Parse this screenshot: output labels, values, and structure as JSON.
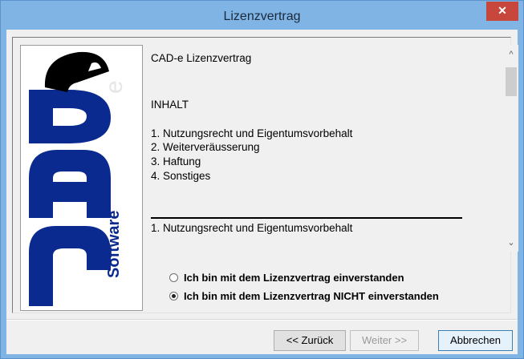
{
  "window": {
    "title": "Lizenzvertrag",
    "close_symbol": "✕"
  },
  "logo": {
    "letters": [
      "C",
      "A",
      "D",
      "e"
    ],
    "side_text": "Software",
    "colors": {
      "primary": "#0b2a8f",
      "black": "#000000"
    }
  },
  "license": {
    "lines": [
      "CAD-e Lizenzvertrag",
      "INHALT",
      "1. Nutzungsrecht und Eigentumsvorbehalt",
      "2. Weiterveräusserung",
      "3. Haftung",
      "4. Sonstiges",
      "1. Nutzungsrecht und Eigentumsvorbehalt"
    ],
    "scroll_up_symbol": "^",
    "scroll_down_symbol": "⌄"
  },
  "options": [
    {
      "label": "Ich bin mit dem Lizenzvertrag einverstanden",
      "checked": false
    },
    {
      "label": "Ich bin mit dem Lizenzvertrag NICHT einverstanden",
      "checked": true
    }
  ],
  "buttons": {
    "back": "<< Zurück",
    "next": "Weiter >>",
    "cancel": "Abbrechen"
  }
}
